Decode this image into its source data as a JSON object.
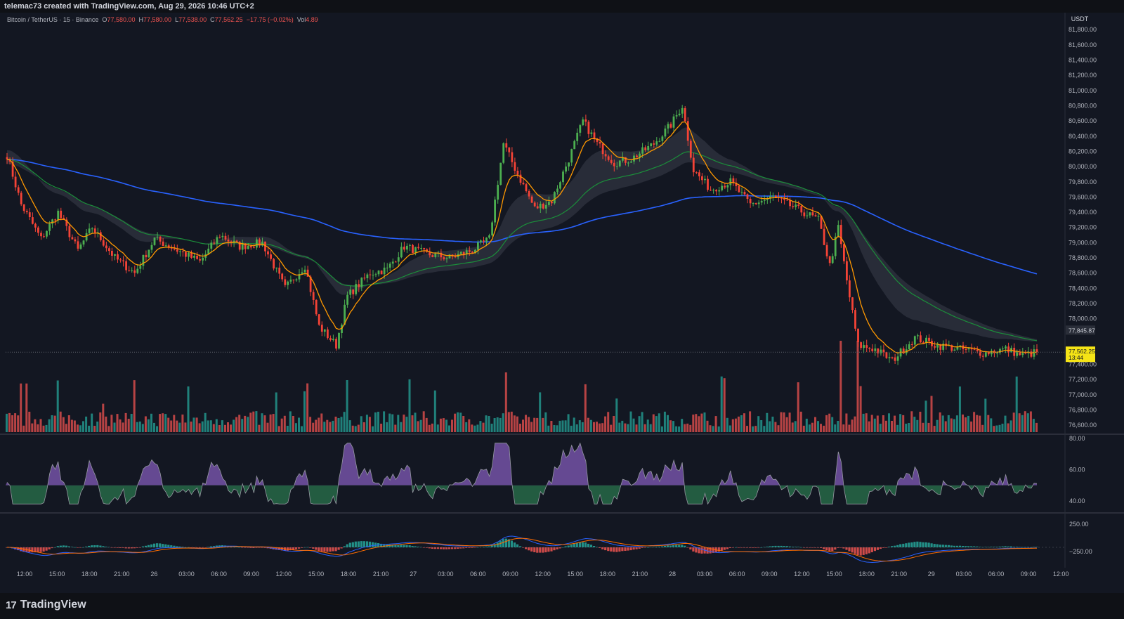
{
  "header": {
    "created_by": "telemac73 created with TradingView.com, Aug 29, 2026 10:46 UTC+2"
  },
  "legend": {
    "symbol": "Bitcoin / TetherUS · 15 · Binance",
    "o_label": "O",
    "o": "77,580.00",
    "h_label": "H",
    "h": "77,580.00",
    "l_label": "L",
    "l": "77,538.00",
    "c_label": "C",
    "c": "77,562.25",
    "change": "−17.75 (−0.02%)",
    "vol_label": "Vol",
    "vol": "4.89"
  },
  "brand": {
    "name": "TradingView",
    "logo": "17"
  },
  "colors": {
    "bg": "#131722",
    "up": "#26a69a",
    "down": "#ef5350",
    "up_candle": "#4caf50",
    "down_candle": "#f44336",
    "ema200": "#2962ff",
    "ema50": "#1b8e3a",
    "fast_ma": "#ff9800",
    "cloud_teal": "#1f5c6b",
    "cloud_grey": "#3a3e4a",
    "rsi_up": "#9c6ade",
    "rsi_down": "#2e8b57",
    "price_tag": "#f5e416"
  },
  "price_axis": {
    "currency": "USDT",
    "ticks": [
      "81,800.00",
      "81,600.00",
      "81,400.00",
      "81,200.00",
      "81,000.00",
      "80,800.00",
      "80,600.00",
      "80,400.00",
      "80,200.00",
      "80,000.00",
      "79,800.00",
      "79,600.00",
      "79,400.00",
      "79,200.00",
      "79,000.00",
      "78,800.00",
      "78,600.00",
      "78,400.00",
      "78,200.00",
      "78,000.00",
      "77,400.00",
      "77,200.00",
      "77,000.00",
      "76,800.00",
      "76,600.00"
    ],
    "marker_price": "77,845.87",
    "last_price": "77,562.25",
    "countdown": "13:44"
  },
  "rsi_axis": {
    "ticks": [
      "80.00",
      "60.00",
      "40.00"
    ]
  },
  "macd_axis": {
    "ticks": [
      "250.00",
      "−250.00"
    ]
  },
  "time_axis": {
    "ticks": [
      "12:00",
      "15:00",
      "18:00",
      "21:00",
      "26",
      "03:00",
      "06:00",
      "09:00",
      "12:00",
      "15:00",
      "18:00",
      "21:00",
      "27",
      "03:00",
      "06:00",
      "09:00",
      "12:00",
      "15:00",
      "18:00",
      "21:00",
      "28",
      "03:00",
      "06:00",
      "09:00",
      "12:00",
      "15:00",
      "18:00",
      "21:00",
      "29",
      "03:00",
      "06:00",
      "09:00",
      "12:00"
    ]
  },
  "chart_data": {
    "type": "candlestick",
    "title": "Bitcoin / TetherUS · 15 · Binance",
    "ylim": [
      76500,
      81950
    ],
    "close_anchors": [
      [
        0,
        80150
      ],
      [
        5,
        79500
      ],
      [
        12,
        79050
      ],
      [
        18,
        79400
      ],
      [
        25,
        78900
      ],
      [
        30,
        79200
      ],
      [
        38,
        78800
      ],
      [
        45,
        78600
      ],
      [
        52,
        79050
      ],
      [
        60,
        78900
      ],
      [
        68,
        78750
      ],
      [
        75,
        79100
      ],
      [
        82,
        78950
      ],
      [
        90,
        79000
      ],
      [
        98,
        78400
      ],
      [
        105,
        78700
      ],
      [
        110,
        77900
      ],
      [
        116,
        77650
      ],
      [
        120,
        78300
      ],
      [
        128,
        78600
      ],
      [
        134,
        78650
      ],
      [
        140,
        78950
      ],
      [
        148,
        78850
      ],
      [
        156,
        78800
      ],
      [
        164,
        78900
      ],
      [
        170,
        79050
      ],
      [
        175,
        80300
      ],
      [
        180,
        79900
      ],
      [
        186,
        79450
      ],
      [
        192,
        79550
      ],
      [
        198,
        80100
      ],
      [
        203,
        80600
      ],
      [
        208,
        80300
      ],
      [
        214,
        80050
      ],
      [
        220,
        80100
      ],
      [
        228,
        80300
      ],
      [
        234,
        80550
      ],
      [
        238,
        80800
      ],
      [
        242,
        79950
      ],
      [
        248,
        79700
      ],
      [
        255,
        79800
      ],
      [
        262,
        79500
      ],
      [
        270,
        79600
      ],
      [
        278,
        79450
      ],
      [
        286,
        79300
      ],
      [
        290,
        78700
      ],
      [
        293,
        79200
      ],
      [
        296,
        78500
      ],
      [
        300,
        77650
      ],
      [
        306,
        77600
      ],
      [
        312,
        77450
      ],
      [
        320,
        77750
      ],
      [
        328,
        77650
      ],
      [
        336,
        77600
      ],
      [
        344,
        77550
      ],
      [
        352,
        77600
      ],
      [
        358,
        77520
      ],
      [
        363,
        77560
      ]
    ],
    "candle_count": 364
  }
}
